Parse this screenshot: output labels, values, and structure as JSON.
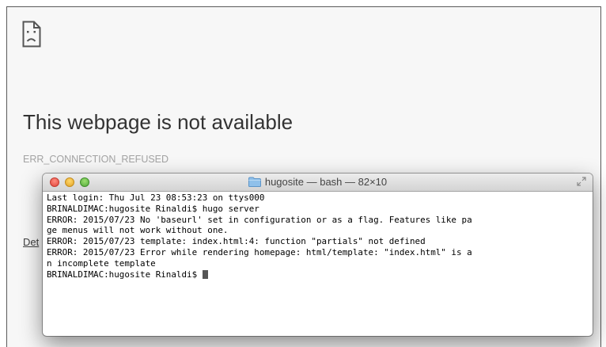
{
  "error_page": {
    "title": "This webpage is not available",
    "error_code": "ERR_CONNECTION_REFUSED",
    "details_link": "Det",
    "icon": "sad-page-icon"
  },
  "terminal": {
    "title": "hugosite — bash — 82×10",
    "title_icon": "folder-icon",
    "lines": [
      "Last login: Thu Jul 23 08:53:23 on ttys000",
      "BRINALDIMAC:hugosite Rinaldi$ hugo server",
      "ERROR: 2015/07/23 No 'baseurl' set in configuration or as a flag. Features like pa",
      "ge menus will not work without one.",
      "ERROR: 2015/07/23 template: index.html:4: function \"partials\" not defined",
      "ERROR: 2015/07/23 Error while rendering homepage: html/template: \"index.html\" is a",
      "n incomplete template"
    ],
    "prompt": "BRINALDIMAC:hugosite Rinaldi$ "
  },
  "colors": {
    "close": "#e0443a",
    "minimize": "#e2a327",
    "zoom": "#53a83a",
    "page_background": "#f7f7f7"
  }
}
